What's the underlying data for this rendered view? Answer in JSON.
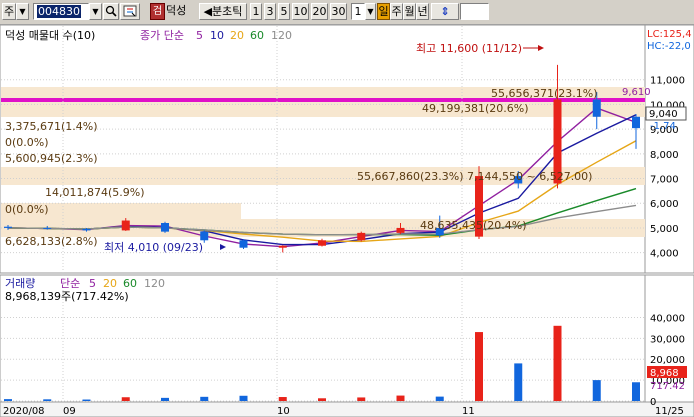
{
  "toolbar": {
    "mode": "주",
    "code": "004830",
    "code_badge": "검",
    "stock_name": "덕성",
    "period_label": "◀분초틱",
    "periods": [
      "1",
      "3",
      "5",
      "10",
      "20",
      "30"
    ],
    "count_value": "1",
    "day_label": "일",
    "week_label": "주",
    "month_label": "월",
    "year_label": "년",
    "arrow_glyph": "⇕"
  },
  "price_panel": {
    "title": "덕성 매물대 수(10)",
    "ma_legend": {
      "label": "종가 단순",
      "periods": [
        "5",
        "10",
        "20",
        "60",
        "120"
      ]
    },
    "lc_label": "LC:125,4",
    "hc_label": "HC:-22,0",
    "high_annotation": "최고 11,600 (11/12)",
    "low_annotation": "최저 4,010 (09/23)",
    "current_price": "9,040",
    "current_change": "-1.74",
    "top_right_value": "9,610",
    "volume_profile_labels": [
      {
        "text": "55,656,371(23.1%)"
      },
      {
        "text": "49,199,381(20.6%)"
      },
      {
        "text": "3,375,671(1.4%)"
      },
      {
        "text": "0(0.0%)"
      },
      {
        "text": "5,600,945(2.3%)"
      },
      {
        "text": "55,667,860(23.3%) 7,144,550 ~ 6,527.00)"
      },
      {
        "text": "14,011,874(5.9%)"
      },
      {
        "text": "0(0.0%)"
      },
      {
        "text": "48,635,435(20.4%)"
      },
      {
        "text": "6,628,133(2.8%)"
      }
    ],
    "y_ticks": [
      "11,000",
      "10,000",
      "9,000",
      "8,000",
      "7,000",
      "6,000",
      "5,000",
      "4,000"
    ]
  },
  "volume_panel": {
    "title": "거래량",
    "ma_legend": {
      "label": "단순",
      "periods": [
        "5",
        "20",
        "60",
        "120"
      ]
    },
    "value_label": "8,968,139주(717.42%)",
    "current_badge": "8,968",
    "current_pct": "717.42",
    "y_ticks": [
      "40,000",
      "30,000",
      "20,000",
      "10,000",
      "0"
    ]
  },
  "x_axis": {
    "labels": [
      "2020/08",
      "09",
      "10",
      "11"
    ],
    "right_label": "11/25"
  },
  "colors": {
    "up": "#e8231a",
    "down": "#1166dd",
    "highlight": "#e010c8",
    "ma5": "#9020a0",
    "ma10": "#1a1aa0",
    "ma20": "#e6a617",
    "ma60": "#1a8a2a",
    "ma120": "#8c8c8c"
  },
  "chart_data": {
    "type": "candlestick",
    "x": [
      "08/03",
      "08/10",
      "08/17",
      "08/24",
      "08/31",
      "09/07",
      "09/14",
      "09/21",
      "09/28",
      "10/05",
      "10/12",
      "10/19",
      "10/26",
      "11/02",
      "11/09",
      "11/16",
      "11/23"
    ],
    "ohlc": [
      [
        5050,
        5120,
        4920,
        5000
      ],
      [
        5000,
        5080,
        4930,
        4960
      ],
      [
        4960,
        5000,
        4850,
        4900
      ],
      [
        4900,
        5400,
        4880,
        5300
      ],
      [
        5200,
        5250,
        4800,
        4850
      ],
      [
        4850,
        4900,
        4400,
        4500
      ],
      [
        4500,
        4550,
        4150,
        4200
      ],
      [
        4200,
        4300,
        4010,
        4280
      ],
      [
        4280,
        4560,
        4250,
        4500
      ],
      [
        4500,
        4850,
        4450,
        4800
      ],
      [
        4800,
        5200,
        4750,
        5000
      ],
      [
        5000,
        5500,
        4600,
        4700
      ],
      [
        4650,
        7500,
        4550,
        7100
      ],
      [
        7100,
        7300,
        6600,
        6800
      ],
      [
        6800,
        11600,
        6600,
        10200
      ],
      [
        10200,
        10500,
        9000,
        9500
      ],
      [
        9500,
        9610,
        8200,
        9040
      ]
    ],
    "volume_k": [
      900,
      800,
      700,
      1800,
      1500,
      2000,
      2500,
      1900,
      1300,
      1700,
      2600,
      2100,
      33000,
      18000,
      36000,
      10000,
      8968
    ],
    "ylim": [
      3500,
      12000
    ],
    "volume_ylim": [
      0,
      45000
    ]
  }
}
